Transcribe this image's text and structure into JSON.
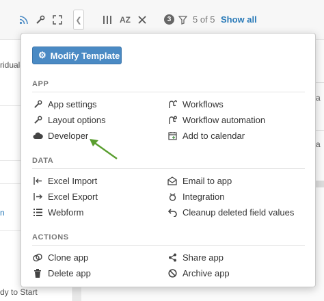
{
  "toolbar": {
    "count_badge": "3",
    "count_text": "5 of 5",
    "show_all": "Show all",
    "sort_label": "AZ"
  },
  "background": {
    "left_text_1": "ridual",
    "left_text_2": "n",
    "left_text_3": "dy to Start",
    "right_text_1": "a",
    "right_text_2": "a"
  },
  "menu": {
    "modify_template": "Modify Template",
    "sections": {
      "app": "APP",
      "data": "DATA",
      "actions": "ACTIONS"
    },
    "app_items": {
      "app_settings": "App settings",
      "layout_options": "Layout options",
      "developer": "Developer",
      "workflows": "Workflows",
      "workflow_automation": "Workflow automation",
      "add_to_calendar": "Add to calendar"
    },
    "data_items": {
      "excel_import": "Excel Import",
      "excel_export": "Excel Export",
      "webform": "Webform",
      "email_to_app": "Email to app",
      "integration": "Integration",
      "cleanup": "Cleanup deleted field values"
    },
    "action_items": {
      "clone_app": "Clone app",
      "delete_app": "Delete app",
      "share_app": "Share app",
      "archive_app": "Archive app"
    }
  },
  "colors": {
    "button_blue": "#4a8ac4",
    "link_blue": "#2a7ab8",
    "arrow_green": "#5a9e2f"
  }
}
